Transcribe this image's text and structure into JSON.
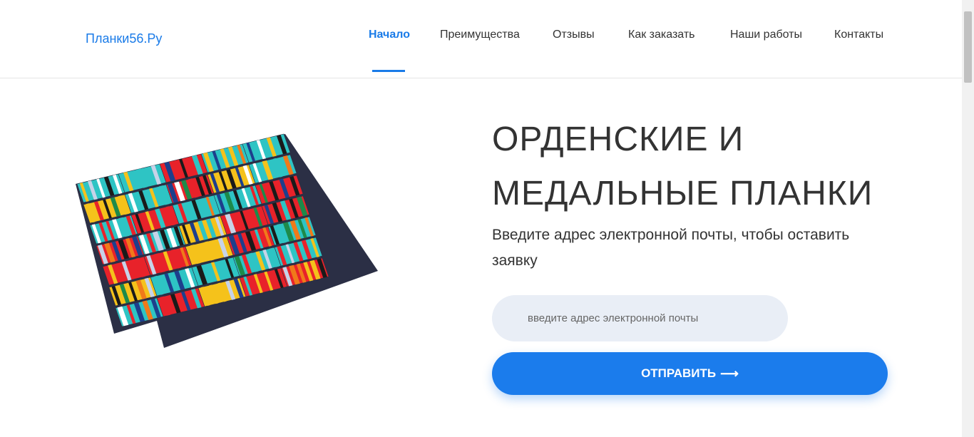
{
  "brand": "Планки56.Ру",
  "nav": {
    "items": [
      {
        "label": "Начало",
        "active": true
      },
      {
        "label": "Преимущества"
      },
      {
        "label": "Отзывы"
      },
      {
        "label": "Как заказать"
      },
      {
        "label": "Наши работы"
      },
      {
        "label": "Контакты"
      }
    ]
  },
  "hero": {
    "title_line1": "ОРДЕНСКИЕ И",
    "title_line2": "МЕДАЛЬНЫЕ ПЛАНКИ",
    "subtitle": "Введите адрес электронной почты, чтобы оставить заявку",
    "email_placeholder": "введите адрес электронной почты",
    "submit_label": "ОТПРАВИТЬ",
    "submit_icon": "arrow-right-icon"
  },
  "colors": {
    "accent": "#1a7be8",
    "input_bg": "#e9eef6",
    "text": "#333333"
  }
}
